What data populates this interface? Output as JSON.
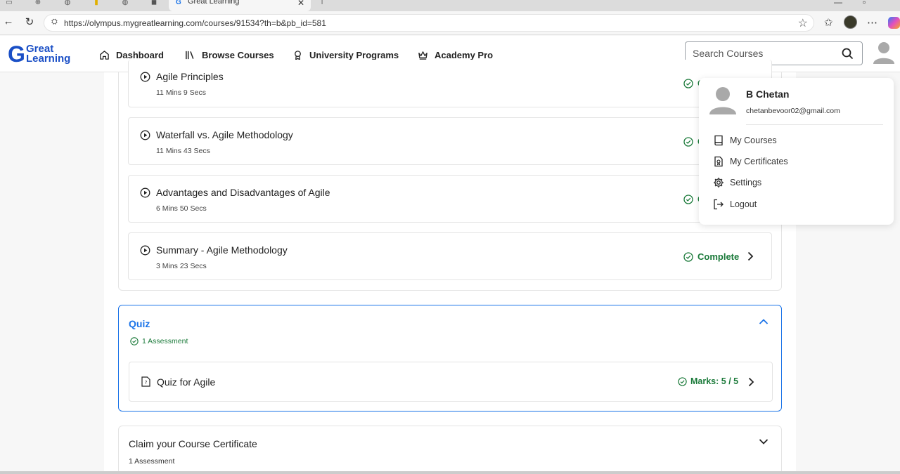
{
  "browser": {
    "tab_title": "Great Learning",
    "tab_close": "✕",
    "url": "https://olympus.mygreatlearning.com/courses/91534?th=b&pb_id=581"
  },
  "header": {
    "logo_line1": "Great",
    "logo_line2": "Learning",
    "nav": [
      {
        "label": "Dashboard",
        "icon": "home-icon"
      },
      {
        "label": "Browse Courses",
        "icon": "library-icon"
      },
      {
        "label": "University Programs",
        "icon": "award-icon"
      },
      {
        "label": "Academy Pro",
        "icon": "crown-icon"
      }
    ],
    "search_placeholder": "Search Courses"
  },
  "lessons": [
    {
      "title": "Agile Principles",
      "duration": "11 Mins 9 Secs",
      "status": "C"
    },
    {
      "title": "Waterfall vs. Agile Methodology",
      "duration": "11 Mins 43 Secs",
      "status": "C"
    },
    {
      "title": "Advantages and Disadvantages of Agile",
      "duration": "6 Mins 50 Secs",
      "status": "C"
    },
    {
      "title": "Summary - Agile Methodology",
      "duration": "3 Mins 23 Secs",
      "status": "Complete"
    }
  ],
  "quiz": {
    "title": "Quiz",
    "subtitle": "1 Assessment",
    "item_title": "Quiz for Agile",
    "marks": "Marks: 5 / 5"
  },
  "certificate": {
    "title": "Claim your Course Certificate",
    "subtitle": "1 Assessment"
  },
  "profile_menu": {
    "name": "B Chetan",
    "email": "chetanbevoor02@gmail.com",
    "items": [
      {
        "label": "My Courses",
        "icon": "book-icon"
      },
      {
        "label": "My Certificates",
        "icon": "certificate-icon"
      },
      {
        "label": "Settings",
        "icon": "gear-icon"
      },
      {
        "label": "Logout",
        "icon": "logout-icon"
      }
    ]
  },
  "colors": {
    "brand_blue": "#1a4fc6",
    "accent_blue": "#1a73e8",
    "success_green": "#1b7a3a"
  }
}
